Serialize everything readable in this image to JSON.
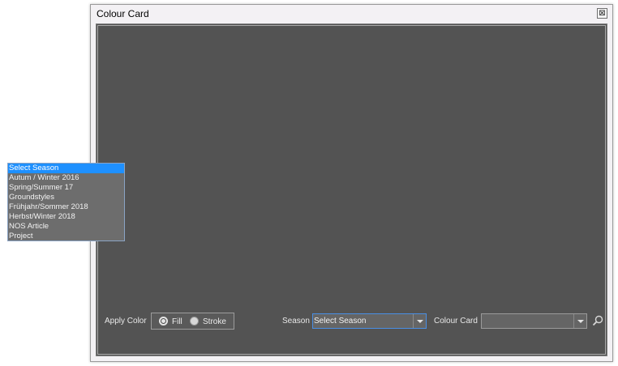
{
  "window": {
    "title": "Colour Card",
    "close_glyph": "⊠"
  },
  "controls": {
    "apply_color_label": "Apply Color",
    "fill_label": "Fill",
    "stroke_label": "Stroke",
    "fill_selected": true,
    "season_label": "Season",
    "season_value": "Select Season",
    "colour_card_label": "Colour Card",
    "colour_card_value": ""
  },
  "season_dropdown": {
    "selected_index": 0,
    "options": [
      "Select Season",
      "Autum / Winter 2016",
      "Spring/Summer 17",
      "Groundstyles",
      "Frühjahr/Sommer 2018",
      "Herbst/Winter 2018",
      "NOS Article",
      "Project"
    ]
  },
  "colors": {
    "panel_background": "#535353",
    "highlight": "#1e90ff",
    "dropdown_background": "#6d6d6d"
  },
  "icons": {
    "search": "search-icon",
    "dropdown_arrow": "chevron-down-icon",
    "close": "close-icon"
  }
}
